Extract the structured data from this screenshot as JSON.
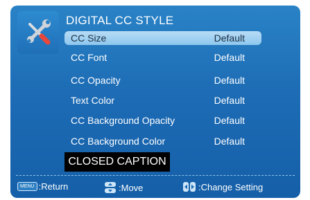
{
  "title": "DIGITAL CC STYLE",
  "menu_items": [
    {
      "label": "CC Size",
      "value": "Default",
      "selected": true
    },
    {
      "label": "CC Font",
      "value": "Default",
      "selected": false
    },
    {
      "label": "CC Opacity",
      "value": "Default",
      "selected": false
    },
    {
      "label": "Text Color",
      "value": "Default",
      "selected": false
    },
    {
      "label": "CC Background Opacity",
      "value": "Default",
      "selected": false
    },
    {
      "label": "CC Background Color",
      "value": "Default",
      "selected": false
    }
  ],
  "preview_text": "CLOSED CAPTION",
  "footer": {
    "menu_key": "MENU",
    "return_label": ":Return",
    "move_label": ":Move",
    "change_label": ":Change Setting"
  },
  "icons": {
    "settings": "tools-icon",
    "menu": "menu-key-icon",
    "move": "up-down-arrows-icon",
    "change": "left-right-arrows-icon"
  },
  "colors": {
    "panel": "#1d6cb5",
    "selected_row": "#a6d3f2",
    "preview_bg": "#000000"
  }
}
